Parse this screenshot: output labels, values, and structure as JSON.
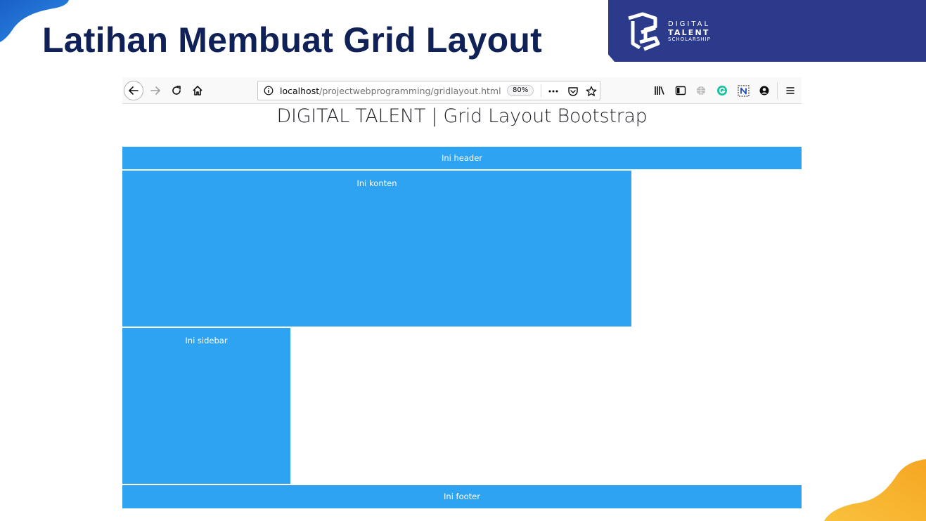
{
  "slide": {
    "title": "Latihan Membuat Grid Layout",
    "brand": {
      "line1": "DIGITAL",
      "line2": "TALENT",
      "line3": "SCHOLARSHIP",
      "logo_icon": "digital-talent-logo",
      "panel_color": "#2c3a8c"
    },
    "accent_colors": {
      "title": "#0f2157",
      "blob_top_left": "#1f6fd1",
      "blob_bottom_right": "#f7b733"
    }
  },
  "browser": {
    "toolbar": {
      "back_icon": "arrow-left-icon",
      "forward_icon": "arrow-right-icon",
      "reload_icon": "reload-icon",
      "home_icon": "home-icon",
      "url_host": "localhost",
      "url_path": "/projectwebprogramming/gridlayout.html",
      "zoom": "80%",
      "right_icons": [
        "library-icon",
        "sidebar-icon",
        "globe-icon",
        "grammarly-icon",
        "notion-icon",
        "account-icon",
        "hamburger-menu-icon"
      ]
    },
    "page": {
      "heading": "DIGITAL TALENT | Grid Layout Bootstrap",
      "block_color": "#2ea3f2",
      "header_label": "Ini header",
      "content_label": "Ini konten",
      "sidebar_label": "Ini sidebar",
      "footer_label": "Ini footer"
    }
  }
}
